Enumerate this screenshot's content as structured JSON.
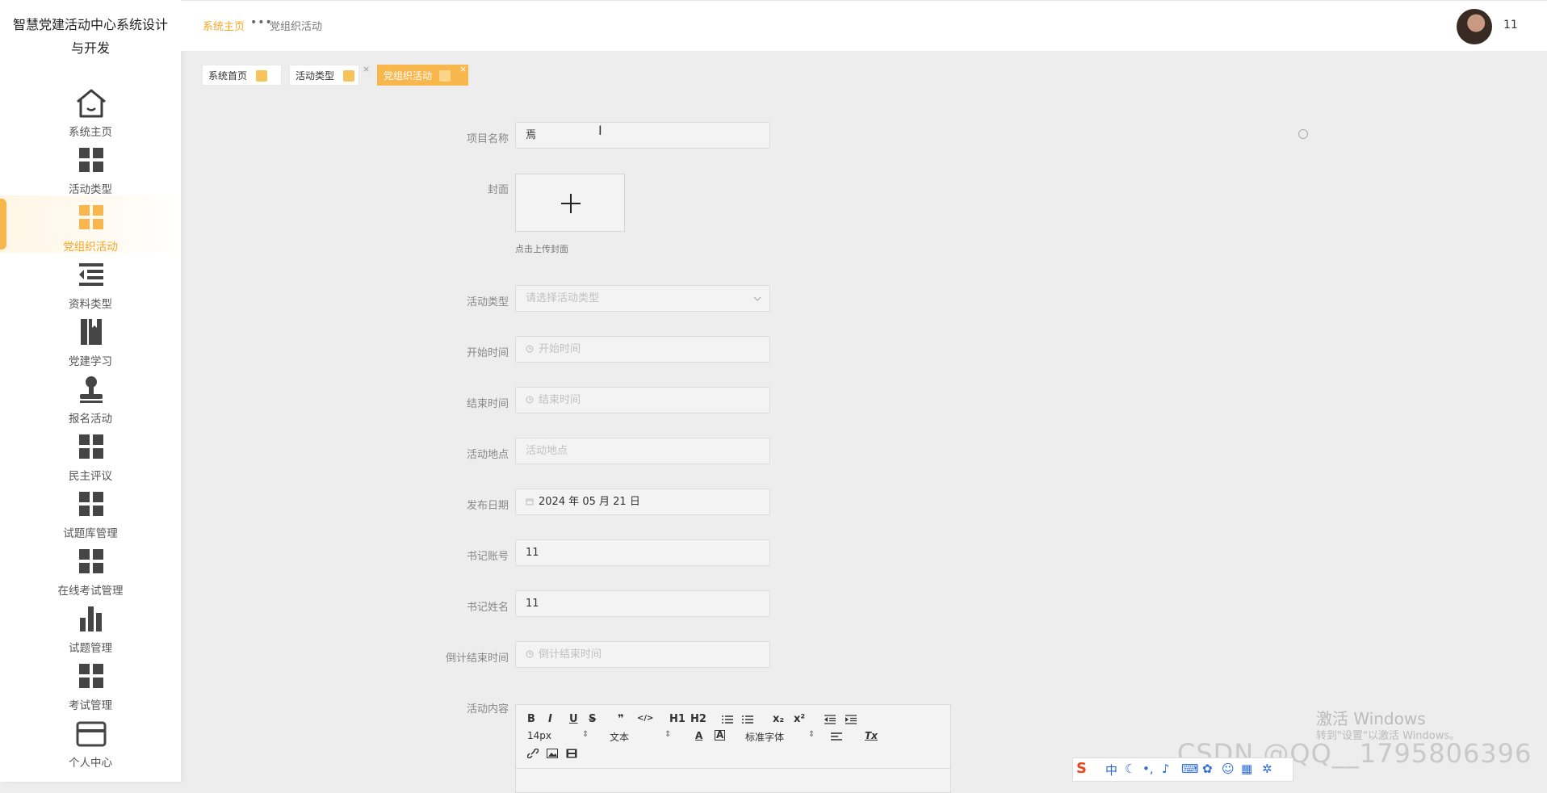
{
  "app": {
    "title": "智慧党建活动中心系统设计与开发"
  },
  "sidebar": {
    "items": [
      {
        "label": "系统主页",
        "icon": "home-icon"
      },
      {
        "label": "活动类型",
        "icon": "grid-icon"
      },
      {
        "label": "党组织活动",
        "icon": "grid-icon",
        "active": true
      },
      {
        "label": "资料类型",
        "icon": "list-indent-icon"
      },
      {
        "label": "党建学习",
        "icon": "book-icon"
      },
      {
        "label": "报名活动",
        "icon": "stamp-icon"
      },
      {
        "label": "民主评议",
        "icon": "grid-icon"
      },
      {
        "label": "试题库管理",
        "icon": "grid-icon"
      },
      {
        "label": "在线考试管理",
        "icon": "grid-icon"
      },
      {
        "label": "试题管理",
        "icon": "bar-chart-icon"
      },
      {
        "label": "考试管理",
        "icon": "grid-icon"
      },
      {
        "label": "个人中心",
        "icon": "card-icon"
      }
    ]
  },
  "header": {
    "breadcrumb_home": "系统主页",
    "breadcrumb_sep": "•••",
    "breadcrumb_current": "党组织活动",
    "username": "11"
  },
  "tags": [
    {
      "label": "系统首页"
    },
    {
      "label": "活动类型",
      "close": "×"
    },
    {
      "label": "党组织活动",
      "close": "×",
      "active": true
    }
  ],
  "form": {
    "project_name": {
      "label": "项目名称",
      "value": "焉"
    },
    "cover": {
      "label": "封面",
      "tip": "点击上传封面"
    },
    "activity_type": {
      "label": "活动类型",
      "placeholder": "请选择活动类型"
    },
    "start_time": {
      "label": "开始时间",
      "placeholder": "开始时间"
    },
    "end_time": {
      "label": "结束时间",
      "placeholder": "结束时间"
    },
    "location": {
      "label": "活动地点",
      "placeholder": "活动地点"
    },
    "publish_date": {
      "label": "发布日期",
      "value": "2024 年 05 月 21 日"
    },
    "secretary_account": {
      "label": "书记账号",
      "value": "11"
    },
    "secretary_name": {
      "label": "书记姓名",
      "value": "11"
    },
    "countdown_end": {
      "label": "倒计结束时间",
      "placeholder": "倒计结束时间"
    },
    "content": {
      "label": "活动内容"
    }
  },
  "editor": {
    "font_size": "14px",
    "text_style": "文本",
    "font_family": "标准字体",
    "buttons": [
      "B",
      "I",
      "U",
      "S",
      "❞",
      "</>",
      "H1",
      "H2",
      "ol",
      "ul",
      "x₂",
      "x²",
      "outdent",
      "indent"
    ]
  },
  "overlay": {
    "activate_windows": "激活 Windows",
    "activate_hint": "转到\"设置\"以激活 Windows。",
    "csdn_watermark": "CSDN @QQ__1795806396",
    "ime_label": "中"
  },
  "colors": {
    "accent": "#f5a623",
    "tag_active": "#f7b74c",
    "sidebar_bg": "#ffffff",
    "page_bg": "#ededed"
  }
}
